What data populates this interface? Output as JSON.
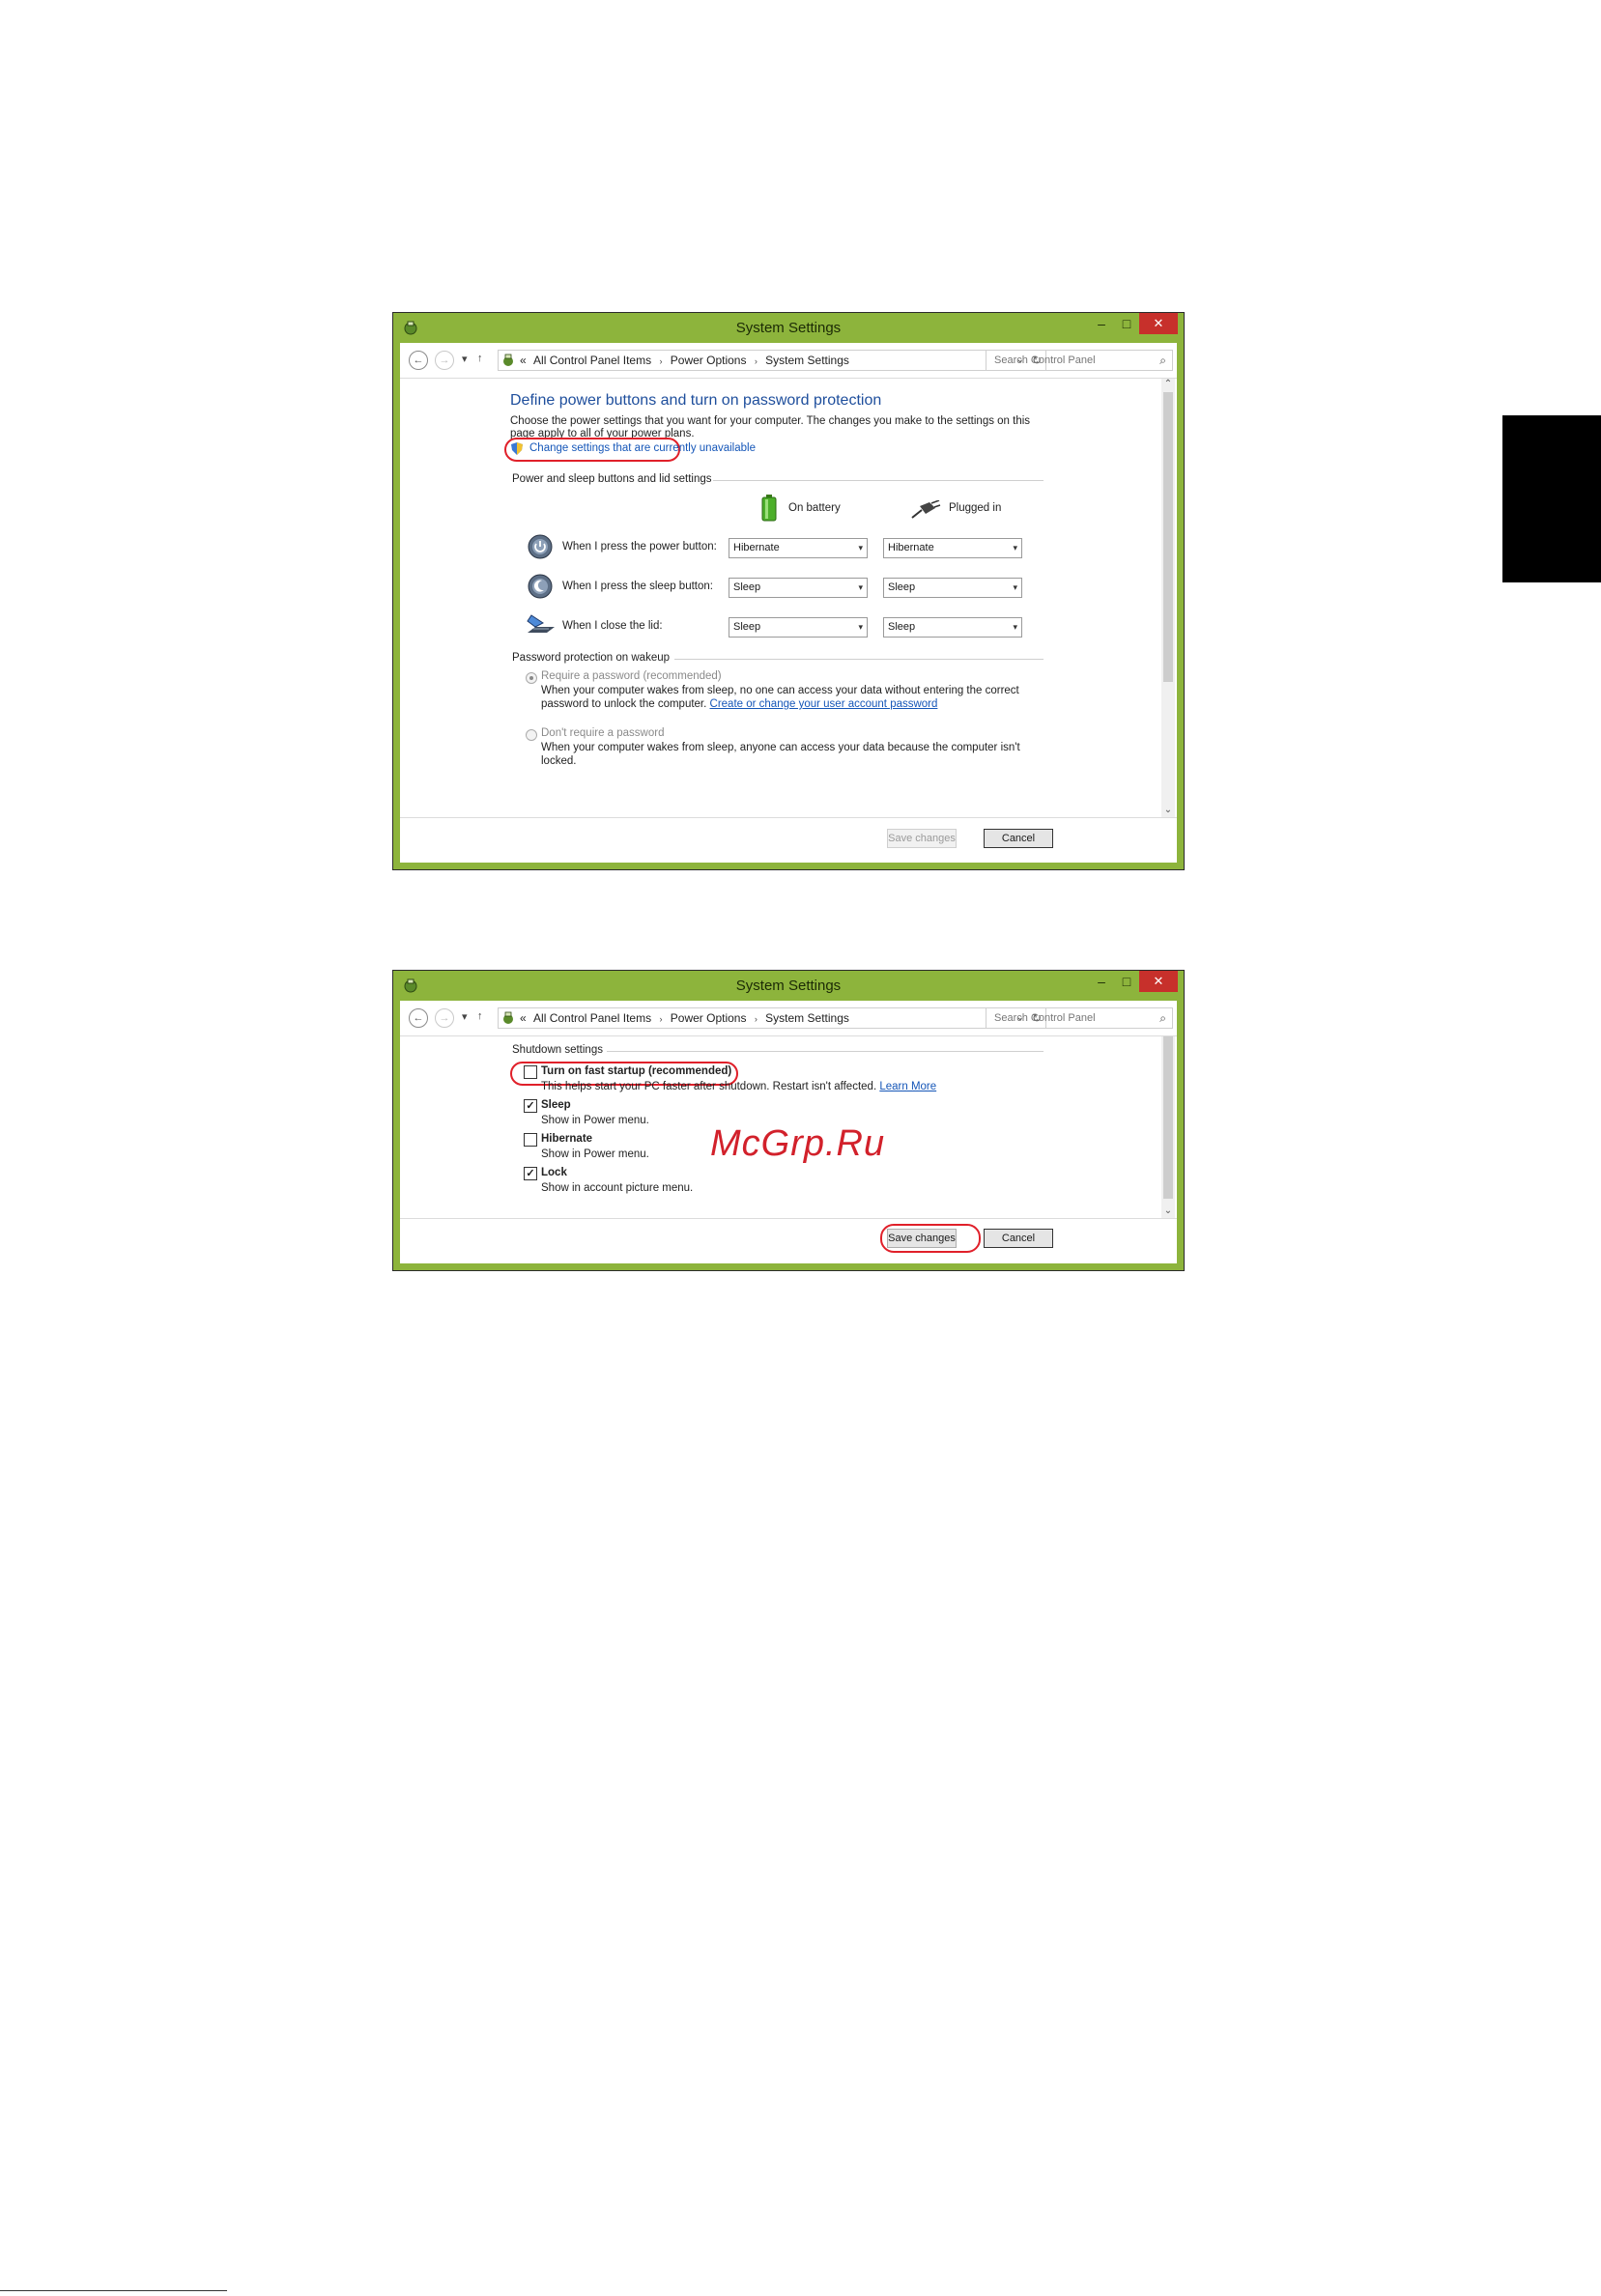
{
  "window1": {
    "title": "System Settings",
    "minimize": "–",
    "maximize": "□",
    "close": "✕",
    "address": {
      "prefix": "«",
      "crumbs": [
        "All Control Panel Items",
        "Power Options",
        "System Settings"
      ],
      "separator": "›"
    },
    "search_placeholder": "Search Control Panel",
    "heading": "Define power buttons and turn on password protection",
    "intro_line1": "Choose the power settings that you want for your computer. The changes you make to the settings on this",
    "intro_line2": "page apply to all of your power plans.",
    "change_settings_link": "Change settings that are currently unavailable",
    "power_section": "Power and sleep buttons and lid settings",
    "col_battery": "On battery",
    "col_plugged": "Plugged in",
    "rows": [
      {
        "label": "When I press the power button:",
        "battery": "Hibernate",
        "plugged": "Hibernate"
      },
      {
        "label": "When I press the sleep button:",
        "battery": "Sleep",
        "plugged": "Sleep"
      },
      {
        "label": "When I close the lid:",
        "battery": "Sleep",
        "plugged": "Sleep"
      }
    ],
    "password_section": "Password protection on wakeup",
    "require_label": "Require a password (recommended)",
    "require_desc1": "When your computer wakes from sleep, no one can access your data without entering the correct",
    "require_desc2": "password to unlock the computer.",
    "require_link": "Create or change your user account password",
    "norequire_label": "Don't require a password",
    "norequire_desc1": "When your computer wakes from sleep, anyone can access your data because the computer isn't",
    "norequire_desc2": "locked.",
    "save_label": "Save changes",
    "cancel_label": "Cancel"
  },
  "window2": {
    "title": "System Settings",
    "minimize": "–",
    "maximize": "□",
    "close": "✕",
    "address": {
      "prefix": "«",
      "crumbs": [
        "All Control Panel Items",
        "Power Options",
        "System Settings"
      ],
      "separator": "›"
    },
    "search_placeholder": "Search Control Panel",
    "shutdown_section": "Shutdown settings",
    "options": [
      {
        "label": "Turn on fast startup (recommended)",
        "desc": "This helps start your PC faster after shutdown. Restart isn't affected.",
        "link": "Learn More",
        "checked": false
      },
      {
        "label": "Sleep",
        "desc": "Show in Power menu.",
        "checked": true
      },
      {
        "label": "Hibernate",
        "desc": "Show in Power menu.",
        "checked": false
      },
      {
        "label": "Lock",
        "desc": "Show in account picture menu.",
        "checked": true
      }
    ],
    "save_label": "Save changes",
    "cancel_label": "Cancel"
  },
  "watermark": "McGrp.Ru",
  "checkmark": "✓",
  "colors": {
    "titlebar": "#8db43c",
    "close_button": "#c7302b",
    "heading_blue": "#1e4e9c",
    "link_blue": "#1556b8",
    "highlight_red": "#e0202a",
    "side_tab": "#000000"
  },
  "icons": [
    "control-panel-icon",
    "back-arrow-icon",
    "forward-arrow-icon",
    "up-arrow-icon",
    "refresh-icon",
    "search-icon",
    "shield-icon",
    "battery-icon",
    "plug-icon",
    "power-button-icon",
    "sleep-button-icon",
    "laptop-lid-icon"
  ]
}
